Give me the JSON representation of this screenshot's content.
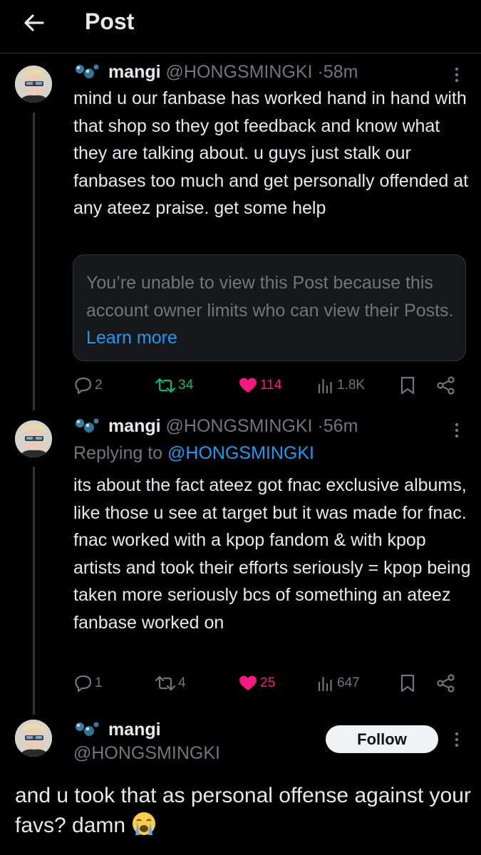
{
  "header": {
    "title": "Post"
  },
  "posts": [
    {
      "name": "mangi",
      "handle": "@HONGSMINGKI",
      "separator": "·",
      "time": "58m",
      "text": "mind u our fanbase has worked hand in hand with that shop so they got feedback and know what they are talking about. u guys just stalk our fanbases too much and get personally offended at any ateez praise. get some help",
      "quoted_notice": {
        "text": "You’re unable to view this Post because this account owner limits who can view their Posts.",
        "link": "Learn more"
      },
      "stats": {
        "replies": "2",
        "reposts": "34",
        "likes": "114",
        "views": "1.8K"
      }
    },
    {
      "name": "mangi",
      "handle": "@HONGSMINGKI",
      "separator": "·",
      "time": "56m",
      "replying_label": "Replying to",
      "replying_to": "@HONGSMINGKI",
      "text": "its about the fact ateez got fnac exclusive albums, like those u see at target but it was made for fnac. fnac worked with a kpop fandom & with kpop artists and took their efforts seriously = kpop being taken more seriously bcs of something an ateez fanbase worked on",
      "stats": {
        "replies": "1",
        "reposts": "4",
        "likes": "25",
        "views": "647"
      }
    }
  ],
  "main_post": {
    "name": "mangi",
    "handle": "@HONGSMINGKI",
    "follow_label": "Follow",
    "text": "and u took that as personal offense against your favs? damn",
    "emoji": "loudly-crying-face"
  },
  "colors": {
    "background": "#000000",
    "text": "#e7e9ea",
    "muted": "#71767b",
    "link": "#1d9bf0",
    "repost": "#00ba7c",
    "like": "#f91880"
  },
  "icons": [
    "back-arrow-icon",
    "bubbles-icon",
    "more-icon",
    "reply-icon",
    "repost-icon",
    "heart-icon",
    "views-icon",
    "bookmark-icon",
    "share-icon"
  ]
}
